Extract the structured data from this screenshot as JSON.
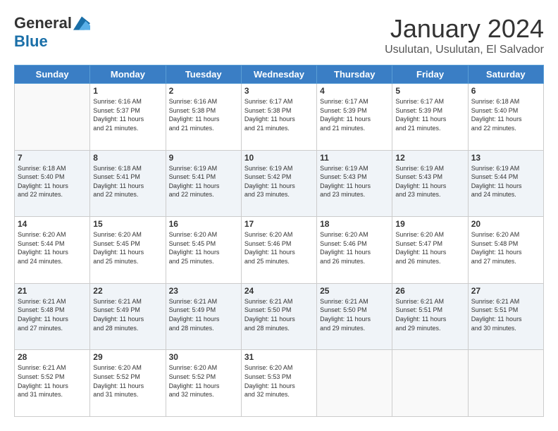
{
  "logo": {
    "general": "General",
    "blue": "Blue"
  },
  "header": {
    "title": "January 2024",
    "location": "Usulutan, Usulutan, El Salvador"
  },
  "weekdays": [
    "Sunday",
    "Monday",
    "Tuesday",
    "Wednesday",
    "Thursday",
    "Friday",
    "Saturday"
  ],
  "weeks": [
    [
      {
        "day": "",
        "info": ""
      },
      {
        "day": "1",
        "info": "Sunrise: 6:16 AM\nSunset: 5:37 PM\nDaylight: 11 hours\nand 21 minutes."
      },
      {
        "day": "2",
        "info": "Sunrise: 6:16 AM\nSunset: 5:38 PM\nDaylight: 11 hours\nand 21 minutes."
      },
      {
        "day": "3",
        "info": "Sunrise: 6:17 AM\nSunset: 5:38 PM\nDaylight: 11 hours\nand 21 minutes."
      },
      {
        "day": "4",
        "info": "Sunrise: 6:17 AM\nSunset: 5:39 PM\nDaylight: 11 hours\nand 21 minutes."
      },
      {
        "day": "5",
        "info": "Sunrise: 6:17 AM\nSunset: 5:39 PM\nDaylight: 11 hours\nand 21 minutes."
      },
      {
        "day": "6",
        "info": "Sunrise: 6:18 AM\nSunset: 5:40 PM\nDaylight: 11 hours\nand 22 minutes."
      }
    ],
    [
      {
        "day": "7",
        "info": "Sunrise: 6:18 AM\nSunset: 5:40 PM\nDaylight: 11 hours\nand 22 minutes."
      },
      {
        "day": "8",
        "info": "Sunrise: 6:18 AM\nSunset: 5:41 PM\nDaylight: 11 hours\nand 22 minutes."
      },
      {
        "day": "9",
        "info": "Sunrise: 6:19 AM\nSunset: 5:41 PM\nDaylight: 11 hours\nand 22 minutes."
      },
      {
        "day": "10",
        "info": "Sunrise: 6:19 AM\nSunset: 5:42 PM\nDaylight: 11 hours\nand 23 minutes."
      },
      {
        "day": "11",
        "info": "Sunrise: 6:19 AM\nSunset: 5:43 PM\nDaylight: 11 hours\nand 23 minutes."
      },
      {
        "day": "12",
        "info": "Sunrise: 6:19 AM\nSunset: 5:43 PM\nDaylight: 11 hours\nand 23 minutes."
      },
      {
        "day": "13",
        "info": "Sunrise: 6:19 AM\nSunset: 5:44 PM\nDaylight: 11 hours\nand 24 minutes."
      }
    ],
    [
      {
        "day": "14",
        "info": "Sunrise: 6:20 AM\nSunset: 5:44 PM\nDaylight: 11 hours\nand 24 minutes."
      },
      {
        "day": "15",
        "info": "Sunrise: 6:20 AM\nSunset: 5:45 PM\nDaylight: 11 hours\nand 25 minutes."
      },
      {
        "day": "16",
        "info": "Sunrise: 6:20 AM\nSunset: 5:45 PM\nDaylight: 11 hours\nand 25 minutes."
      },
      {
        "day": "17",
        "info": "Sunrise: 6:20 AM\nSunset: 5:46 PM\nDaylight: 11 hours\nand 25 minutes."
      },
      {
        "day": "18",
        "info": "Sunrise: 6:20 AM\nSunset: 5:46 PM\nDaylight: 11 hours\nand 26 minutes."
      },
      {
        "day": "19",
        "info": "Sunrise: 6:20 AM\nSunset: 5:47 PM\nDaylight: 11 hours\nand 26 minutes."
      },
      {
        "day": "20",
        "info": "Sunrise: 6:20 AM\nSunset: 5:48 PM\nDaylight: 11 hours\nand 27 minutes."
      }
    ],
    [
      {
        "day": "21",
        "info": "Sunrise: 6:21 AM\nSunset: 5:48 PM\nDaylight: 11 hours\nand 27 minutes."
      },
      {
        "day": "22",
        "info": "Sunrise: 6:21 AM\nSunset: 5:49 PM\nDaylight: 11 hours\nand 28 minutes."
      },
      {
        "day": "23",
        "info": "Sunrise: 6:21 AM\nSunset: 5:49 PM\nDaylight: 11 hours\nand 28 minutes."
      },
      {
        "day": "24",
        "info": "Sunrise: 6:21 AM\nSunset: 5:50 PM\nDaylight: 11 hours\nand 28 minutes."
      },
      {
        "day": "25",
        "info": "Sunrise: 6:21 AM\nSunset: 5:50 PM\nDaylight: 11 hours\nand 29 minutes."
      },
      {
        "day": "26",
        "info": "Sunrise: 6:21 AM\nSunset: 5:51 PM\nDaylight: 11 hours\nand 29 minutes."
      },
      {
        "day": "27",
        "info": "Sunrise: 6:21 AM\nSunset: 5:51 PM\nDaylight: 11 hours\nand 30 minutes."
      }
    ],
    [
      {
        "day": "28",
        "info": "Sunrise: 6:21 AM\nSunset: 5:52 PM\nDaylight: 11 hours\nand 31 minutes."
      },
      {
        "day": "29",
        "info": "Sunrise: 6:20 AM\nSunset: 5:52 PM\nDaylight: 11 hours\nand 31 minutes."
      },
      {
        "day": "30",
        "info": "Sunrise: 6:20 AM\nSunset: 5:52 PM\nDaylight: 11 hours\nand 32 minutes."
      },
      {
        "day": "31",
        "info": "Sunrise: 6:20 AM\nSunset: 5:53 PM\nDaylight: 11 hours\nand 32 minutes."
      },
      {
        "day": "",
        "info": ""
      },
      {
        "day": "",
        "info": ""
      },
      {
        "day": "",
        "info": ""
      }
    ]
  ]
}
